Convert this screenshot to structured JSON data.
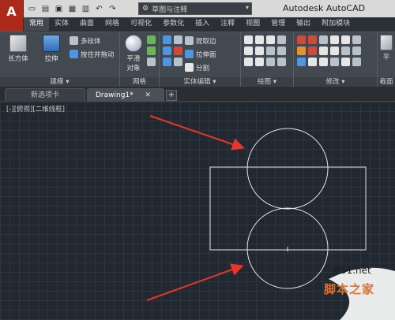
{
  "title_bar": {
    "logo": "A",
    "workspace": "草图与注释",
    "app_title": "Autodesk AutoCAD",
    "qat_icons": [
      "new-icon",
      "open-icon",
      "save-icon",
      "save-as-icon",
      "print-icon",
      "undo-icon",
      "redo-icon"
    ]
  },
  "ribbon": {
    "tabs": [
      "常用",
      "实体",
      "曲面",
      "网格",
      "可视化",
      "参数化",
      "插入",
      "注释",
      "视图",
      "管理",
      "输出",
      "附加模块"
    ],
    "active_tab": "常用",
    "panels": {
      "modeling": {
        "title": "建模 ▾",
        "box": "长方体",
        "extrude": "拉伸",
        "polysolid": "多段体",
        "presspull": "按住并拖动"
      },
      "mesh": {
        "title": "网格",
        "smooth": "平滑\n对象",
        "smooth_line1": "平滑",
        "smooth_line2": "对象"
      },
      "solid_editing": {
        "title": "实体编辑 ▾",
        "extract_edges": "提取边",
        "extrude_faces": "拉伸面",
        "separate": "分割"
      },
      "draw": {
        "title": "绘图 ▾"
      },
      "modify": {
        "title": "修改 ▾"
      },
      "section": {
        "title": "截面",
        "flat": "平"
      }
    }
  },
  "file_tabs": {
    "start": "新选项卡",
    "drawing": "Drawing1*",
    "close": "✕",
    "new": "+"
  },
  "canvas": {
    "view_label": "[-][俯视][二维线框]"
  },
  "watermark": {
    "site": "jb51.net",
    "name": "脚本之家"
  },
  "colors": {
    "arrow": "#e8342a",
    "linework": "#e6e6e6",
    "canvas_bg": "#212830"
  }
}
